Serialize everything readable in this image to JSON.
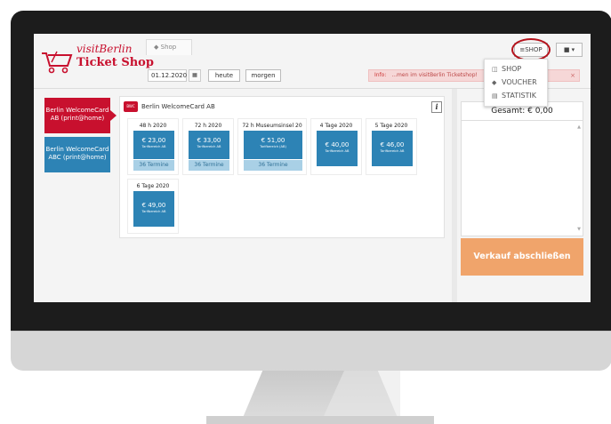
{
  "header": {
    "logo_line1": "visitBerlin",
    "logo_line2": "Ticket Shop",
    "tab_label": "Shop",
    "date_value": "01.12.2020",
    "calendar_icon": "calendar-icon",
    "today_label": "heute",
    "tomorrow_label": "morgen",
    "info_label": "Info:",
    "info_text": "...men im visitBerlin Ticketshop!",
    "info_tail": "n ii",
    "shop_button_label": "≡SHOP",
    "user_button_label": "▲ ▾"
  },
  "dropdown": {
    "items": [
      {
        "icon": "cart-icon",
        "label": "SHOP"
      },
      {
        "icon": "tag-icon",
        "label": "VOUCHER"
      },
      {
        "icon": "chart-icon",
        "label": "STATISTIK"
      }
    ]
  },
  "sidebar": {
    "items": [
      {
        "label": "Berlin WelcomeCard AB (print@home)",
        "active": true
      },
      {
        "label": "Berlin WelcomeCard ABC (print@home)",
        "active": false
      }
    ]
  },
  "products": {
    "panel_title": "Berlin WelcomeCard AB",
    "info_icon": "i",
    "items": [
      {
        "title": "48 h 2020",
        "price": "€ 23,00",
        "zone": "Tarifbereich AB",
        "termine": "36 Termine"
      },
      {
        "title": "72 h 2020",
        "price": "€ 33,00",
        "zone": "Tarifbereich AB",
        "termine": "36 Termine"
      },
      {
        "title": "72 h Museumsinsel 20",
        "price": "€ 51,00",
        "zone": "Tarifbereich (AB)",
        "termine": "36 Termine"
      },
      {
        "title": "4 Tage 2020",
        "price": "€ 40,00",
        "zone": "Tarifbereich AB",
        "termine": ""
      },
      {
        "title": "5 Tage 2020",
        "price": "€ 46,00",
        "zone": "Tarifbereich AB",
        "termine": ""
      },
      {
        "title": "6 Tage 2020",
        "price": "€ 49,00",
        "zone": "Tarifbereich AB",
        "termine": ""
      }
    ]
  },
  "cart": {
    "total_label": "Gesamt: € 0,00",
    "checkout_label": "Verkauf abschließen"
  },
  "colors": {
    "brand_red": "#c8102e",
    "accent_blue": "#2d83b5",
    "checkout_orange": "#f0a46b"
  }
}
